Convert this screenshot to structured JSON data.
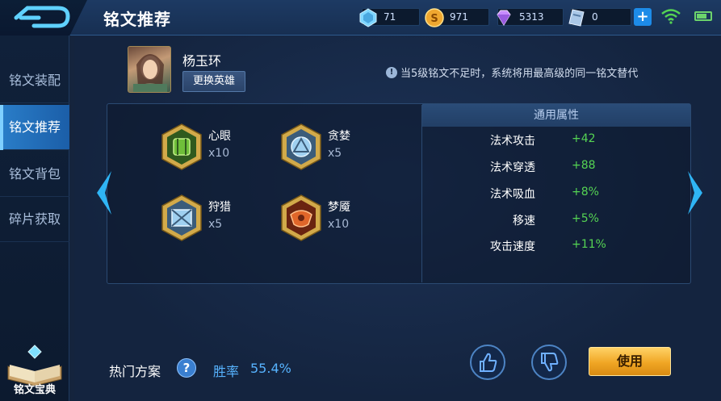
{
  "header": {
    "title": "铭文推荐",
    "resources": [
      {
        "icon": "diamond-icon",
        "value": "71"
      },
      {
        "icon": "gold-coin-icon",
        "value": "971"
      },
      {
        "icon": "purple-gem-icon",
        "value": "5313"
      },
      {
        "icon": "voucher-icon",
        "value": "0"
      }
    ],
    "add_label": "+"
  },
  "sidebar": {
    "items": [
      {
        "label": "铭文装配",
        "active": false
      },
      {
        "label": "铭文推荐",
        "active": true
      },
      {
        "label": "铭文背包",
        "active": false
      },
      {
        "label": "碎片获取",
        "active": false
      }
    ],
    "codex_label": "铭文宝典"
  },
  "hero": {
    "name": "杨玉环",
    "change_label": "更换英雄"
  },
  "notice": "当5级铭文不足时，系统将用最高级的同一铭文替代",
  "runes": [
    {
      "name": "心眼",
      "count": "x10",
      "color": "#6fbf3a"
    },
    {
      "name": "贪婪",
      "count": "x5",
      "color": "#7fb4e0"
    },
    {
      "name": "狩猎",
      "count": "x5",
      "color": "#7fb4e0"
    },
    {
      "name": "梦魇",
      "count": "x10",
      "color": "#e0662a"
    }
  ],
  "attributes": {
    "header": "通用属性",
    "rows": [
      {
        "name": "法术攻击",
        "value": "+42"
      },
      {
        "name": "法术穿透",
        "value": "+88"
      },
      {
        "name": "法术吸血",
        "value": "+8%"
      },
      {
        "name": "移速",
        "value": "+5%"
      },
      {
        "name": "攻击速度",
        "value": "+11%"
      }
    ]
  },
  "footer": {
    "hot_label": "热门方案",
    "help_label": "?",
    "winrate_label": "胜率",
    "winrate_value": "55.4%",
    "use_label": "使用"
  }
}
